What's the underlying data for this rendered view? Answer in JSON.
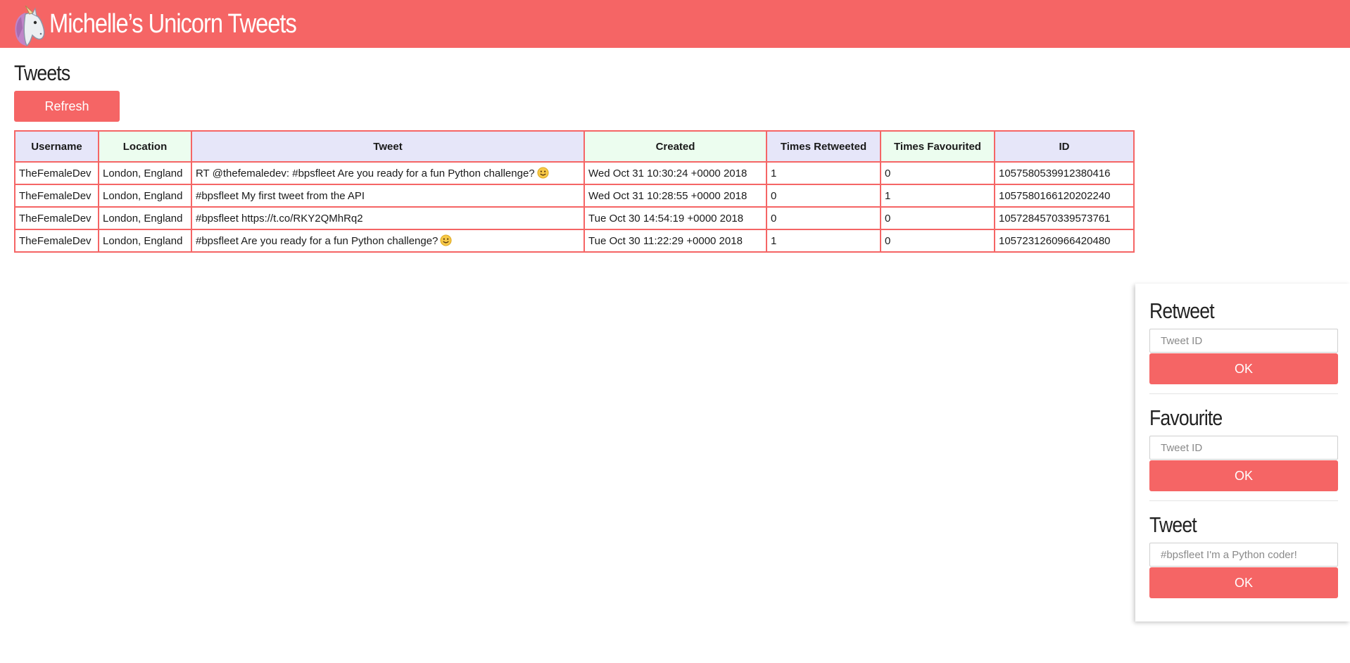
{
  "header": {
    "title": "Michelle’s Unicorn Tweets",
    "logo_icon": "unicorn-icon",
    "background_color": "#f56565"
  },
  "main": {
    "section_title": "Tweets",
    "refresh_label": "Refresh",
    "table": {
      "columns": [
        "Username",
        "Location",
        "Tweet",
        "Created",
        "Times Retweeted",
        "Times Favourited",
        "ID"
      ],
      "rows": [
        {
          "username": "TheFemaleDev",
          "location": "London, England",
          "tweet": "RT @thefemaledev: #bpsfleet Are you ready for a fun Python challenge?",
          "has_emoji": true,
          "created": "Wed Oct 31 10:30:24 +0000 2018",
          "retweets": "1",
          "favourites": "0",
          "id": "1057580539912380416"
        },
        {
          "username": "TheFemaleDev",
          "location": "London, England",
          "tweet": "#bpsfleet My first tweet from the API",
          "has_emoji": false,
          "created": "Wed Oct 31 10:28:55 +0000 2018",
          "retweets": "0",
          "favourites": "1",
          "id": "1057580166120202240"
        },
        {
          "username": "TheFemaleDev",
          "location": "London, England",
          "tweet": "#bpsfleet https://t.co/RKY2QMhRq2",
          "has_emoji": false,
          "created": "Tue Oct 30 14:54:19 +0000 2018",
          "retweets": "0",
          "favourites": "0",
          "id": "1057284570339573761"
        },
        {
          "username": "TheFemaleDev",
          "location": "London, England",
          "tweet": "#bpsfleet Are you ready for a fun Python challenge?",
          "has_emoji": true,
          "created": "Tue Oct 30 11:22:29 +0000 2018",
          "retweets": "1",
          "favourites": "0",
          "id": "1057231260966420480"
        }
      ]
    }
  },
  "side_panel": {
    "retweet": {
      "title": "Retweet",
      "placeholder": "Tweet ID",
      "ok_label": "OK"
    },
    "favourite": {
      "title": "Favourite",
      "placeholder": "Tweet ID",
      "ok_label": "OK"
    },
    "tweet": {
      "title": "Tweet",
      "placeholder": "#bpsfleet I'm a Python coder!",
      "ok_label": "OK"
    }
  },
  "colors": {
    "accent": "#f56565",
    "header_cell_purple": "#e6e6f9",
    "header_cell_green": "#ecfdef"
  }
}
